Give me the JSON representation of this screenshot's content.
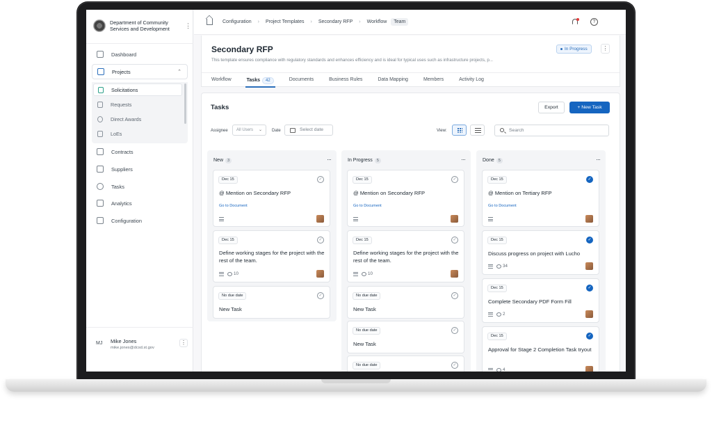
{
  "sidebar": {
    "org_name": "Department of Community Services and Development",
    "nav": {
      "dashboard": "Dashboard",
      "projects": "Projects",
      "contracts": "Contracts",
      "suppliers": "Suppliers",
      "tasks": "Tasks",
      "analytics": "Analytics",
      "configuration": "Configuration"
    },
    "sub_items": [
      "Solicitations",
      "Requests",
      "Direct Awards",
      "LoEs"
    ],
    "user": {
      "initials": "MJ",
      "name": "Mike Jones",
      "email": "mike.jones@dcsd.st.gov"
    }
  },
  "breadcrumb": [
    "Configuration",
    "Project Templates",
    "Secondary RFP",
    "Workflow",
    "Team"
  ],
  "header": {
    "title": "Secondary RFP",
    "description": "This template ensures compliance with regulatory standards and enhances efficiency and is ideal for typical uses such as infrastructure projects, p...",
    "status": "In Progress",
    "tabs": [
      "Workflow",
      "Tasks",
      "Documents",
      "Business Rules",
      "Data Mapping",
      "Members",
      "Activity Log"
    ],
    "tasks_count": "42"
  },
  "tasks": {
    "title": "Tasks",
    "export_label": "Export",
    "new_task_label": "+ New Task",
    "assignee_label": "Assignee",
    "assignee_value": "All Users",
    "date_label": "Date",
    "date_placeholder": "Select date",
    "view_label": "View:",
    "search_placeholder": "Search"
  },
  "columns": [
    {
      "name": "New",
      "count": "3",
      "cards": [
        {
          "due": "Dec 15",
          "title": "@ Mention on Secondary RFP",
          "link": "Go to Document",
          "comments": "",
          "done": false
        },
        {
          "due": "Dec 15",
          "title": "Define working stages for the project with the rest of the team.",
          "link": "",
          "comments": "10",
          "done": false
        },
        {
          "due": "No due date",
          "title": "New Task",
          "link": "",
          "comments": "",
          "done": false
        }
      ]
    },
    {
      "name": "In Progress",
      "count": "5",
      "cards": [
        {
          "due": "Dec 15",
          "title": "@ Mention on Secondary RFP",
          "link": "Go to Document",
          "comments": "",
          "done": false
        },
        {
          "due": "Dec 15",
          "title": "Define working stages for the project with the rest of the team.",
          "link": "",
          "comments": "10",
          "done": false
        },
        {
          "due": "No due date",
          "title": "New Task",
          "link": "",
          "comments": "",
          "done": false
        },
        {
          "due": "No due date",
          "title": "New Task",
          "link": "",
          "comments": "",
          "done": false
        },
        {
          "due": "No due date",
          "title": "",
          "link": "",
          "comments": "",
          "done": false
        }
      ]
    },
    {
      "name": "Done",
      "count": "5",
      "cards": [
        {
          "due": "Dec 15",
          "title": "@ Mention on Tertiary RFP",
          "link": "Go to Document",
          "comments": "",
          "done": true
        },
        {
          "due": "Dec 15",
          "title": "Discuss progress on project with Lucho",
          "link": "",
          "comments": "34",
          "done": true
        },
        {
          "due": "Dec 15",
          "title": "Complete Secondary PDF Form Fill",
          "link": "",
          "comments": "2",
          "done": true
        },
        {
          "due": "Dec 15",
          "title": "Approval for Stage 2 Completion Task tryout",
          "link": "",
          "comments": "4",
          "done": true
        }
      ]
    }
  ],
  "icons": [
    "home-icon",
    "bell-icon",
    "help-icon",
    "search-icon",
    "calendar-icon",
    "grid-view-icon",
    "list-view-icon",
    "check-circle-icon",
    "comment-icon",
    "description-icon",
    "more-icon",
    "chevron-up-icon",
    "chevron-down-icon"
  ],
  "colors": {
    "accent": "#1565c0",
    "notification_dot": "#e03b3b"
  }
}
